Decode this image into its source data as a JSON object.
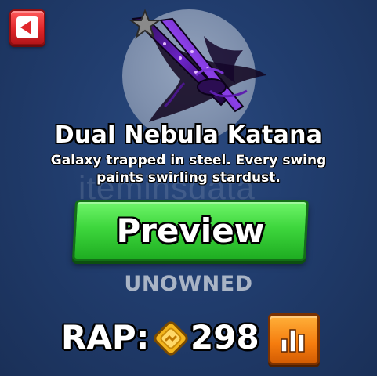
{
  "item": {
    "name": "Dual Nebula Katana",
    "description": "Galaxy trapped in steel. Every swing paints swirling stardust.",
    "status": "UNOWNED"
  },
  "watermark": {
    "text": "iteminsdata"
  },
  "buttons": {
    "preview_label": "Preview"
  },
  "rap": {
    "label": "RAP:",
    "value": "298"
  },
  "icons": {
    "back": "back-arrow-icon",
    "favorite": "star-icon",
    "currency": "coin-icon",
    "chart": "bar-chart-icon"
  },
  "colors": {
    "background": "#213d6e",
    "preview_green": "#3ed63d",
    "back_red": "#e0262a",
    "chart_orange": "#f57c0e",
    "status_gray": "#a9b4c5",
    "coin_gold": "#f3b51e"
  }
}
